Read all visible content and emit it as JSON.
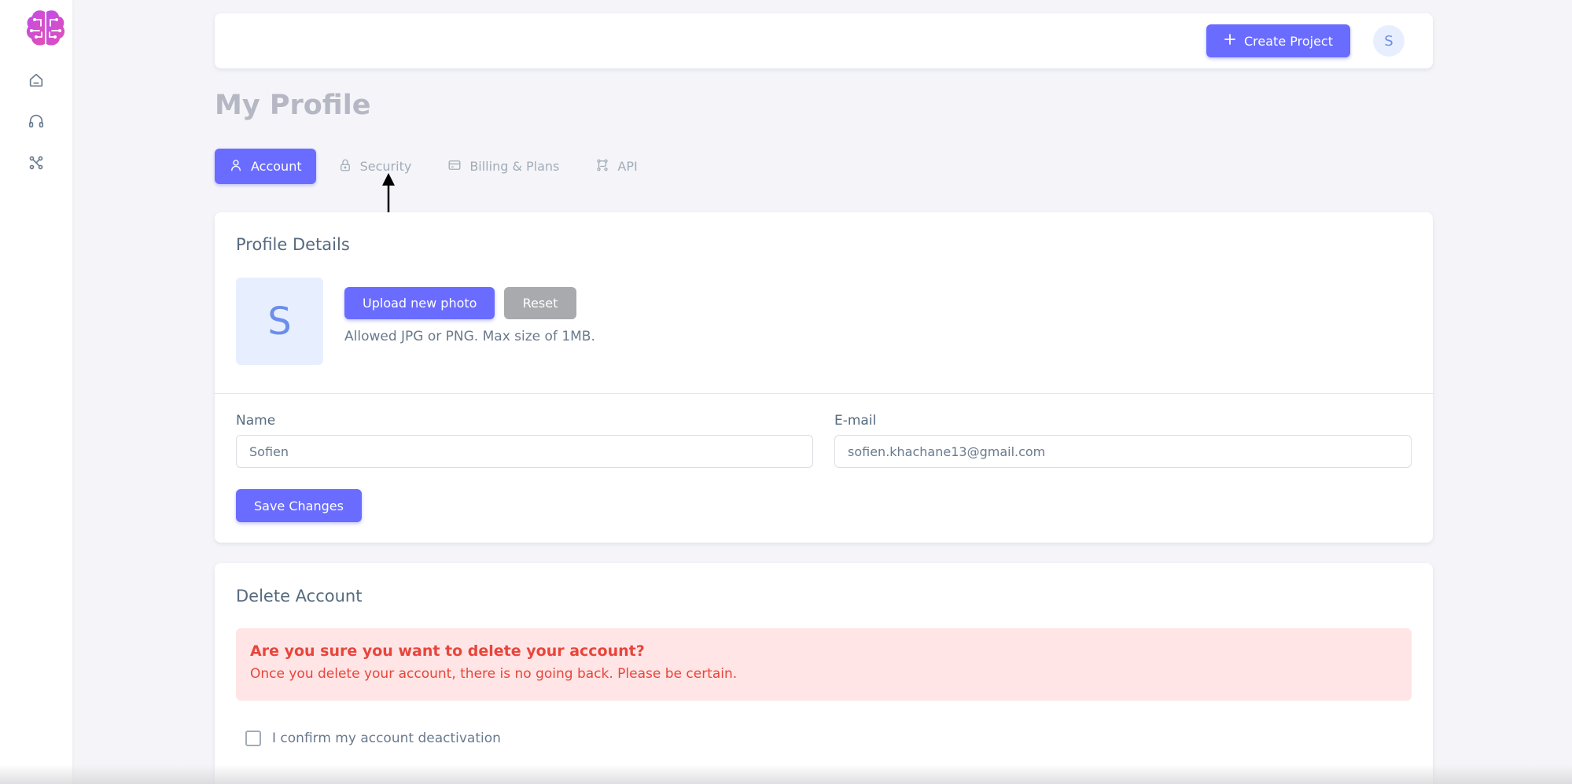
{
  "topbar": {
    "create_label": "Create Project",
    "avatar_initial": "S"
  },
  "page": {
    "title": "My Profile"
  },
  "tabs": [
    {
      "label": "Account",
      "icon": "user-icon",
      "active": true
    },
    {
      "label": "Security",
      "icon": "lock-icon",
      "active": false
    },
    {
      "label": "Billing & Plans",
      "icon": "credit-card-icon",
      "active": false
    },
    {
      "label": "API",
      "icon": "api-icon",
      "active": false
    }
  ],
  "sidebar": {
    "items": [
      {
        "icon": "home-icon"
      },
      {
        "icon": "headphones-icon"
      },
      {
        "icon": "nodes-icon"
      }
    ]
  },
  "profile": {
    "title": "Profile Details",
    "photo_initial": "S",
    "upload_label": "Upload new photo",
    "reset_label": "Reset",
    "hint": "Allowed JPG or PNG. Max size of 1MB.",
    "name_label": "Name",
    "name_value": "Sofien",
    "email_label": "E-mail",
    "email_value": "sofien.khachane13@gmail.com",
    "save_label": "Save Changes"
  },
  "delete": {
    "title": "Delete Account",
    "alert_title": "Are you sure you want to delete your account?",
    "alert_text": "Once you delete your account, there is no going back. Please be certain.",
    "confirm_label": "I confirm my account deactivation"
  },
  "colors": {
    "primary": "#696cff",
    "danger": "#e8453c",
    "danger_bg": "#ffe5e5"
  }
}
